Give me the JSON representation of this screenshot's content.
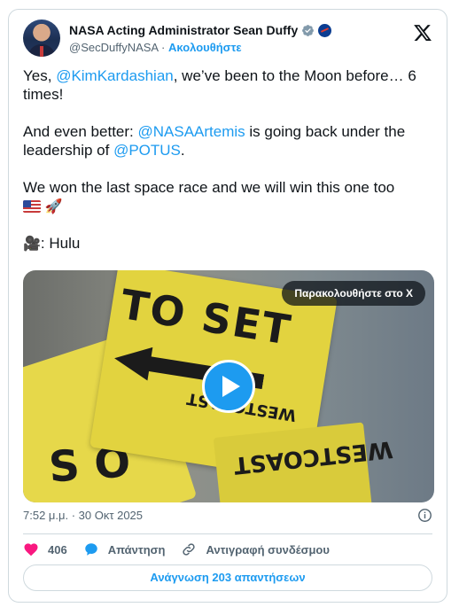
{
  "author": {
    "name": "NASA Acting Administrator Sean Duffy",
    "handle": "@SecDuffyNASA",
    "separator": "·",
    "follow_label": "Ακολουθήστε"
  },
  "tweet": {
    "line1_prefix": "Yes, ",
    "line1_mention": "@KimKardashian",
    "line1_suffix": ", we’ve been to the Moon before… 6 times!",
    "line2_prefix": "And even better: ",
    "line2_mention": "@NASAArtemis",
    "line2_middle": " is going back under the leadership of ",
    "line2_mention2": "@POTUS",
    "line2_suffix": ".",
    "line3": "We won the last space race and we will win this one too",
    "line3_emoji": "🚀",
    "line4_emoji": "🎥",
    "line4_text": ": Hulu"
  },
  "media": {
    "watch_label": "Παρακολουθήστε στο X",
    "sign_text_1": "TO SET",
    "sign_text_small": "WESTCOAST",
    "sign_text_2": "S O",
    "sign_text_3": "WESTCOAST"
  },
  "meta": {
    "timestamp": "7:52 μ.μ. · 30 Οκτ 2025"
  },
  "actions": {
    "like_count": "406",
    "reply_label": "Απάντηση",
    "copy_link_label": "Αντιγραφή συνδέσμου"
  },
  "read_replies_label": "Ανάγνωση 203 απαντήσεων",
  "colors": {
    "accent": "#1d9bf0",
    "like": "#f91880",
    "text": "#0f1419",
    "secondary": "#536471"
  }
}
